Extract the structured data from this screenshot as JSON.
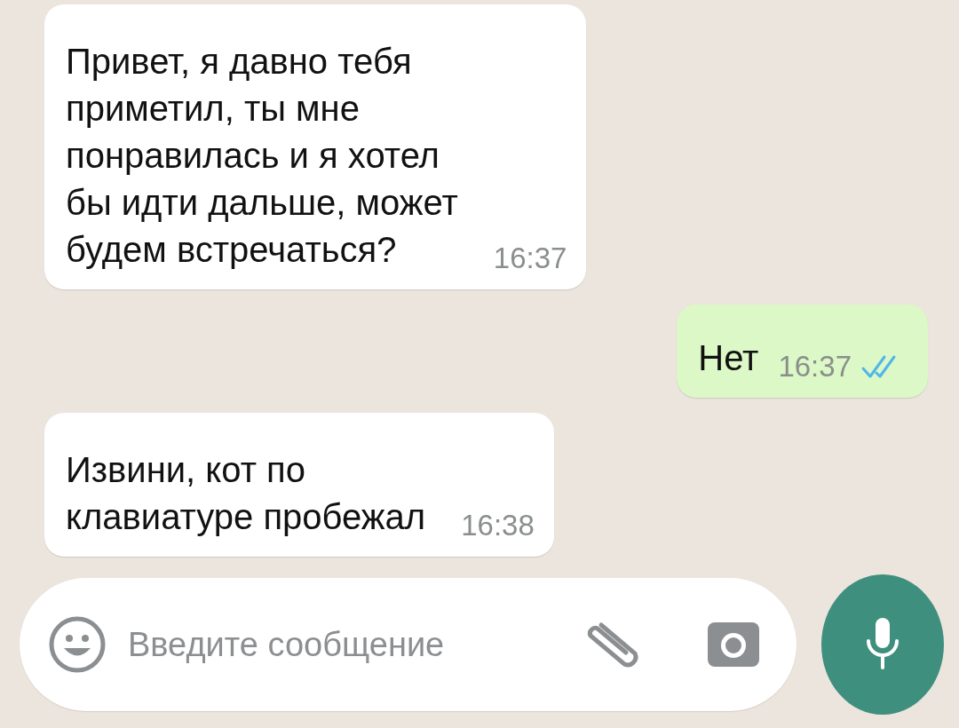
{
  "messages": [
    {
      "kind": "incoming",
      "text": "Привет, я давно тебя\nприметил, ты мне\nпонравилась и я хотел\nбы идти дальше, может\nбудем встречаться?",
      "time": "16:37"
    },
    {
      "kind": "outgoing",
      "text": "Нет",
      "time": "16:37",
      "read": true
    },
    {
      "kind": "incoming",
      "text": "Извини, кот по\nклавиатуре пробежал",
      "time": "16:38"
    }
  ],
  "composer": {
    "placeholder": "Введите сообщение"
  }
}
